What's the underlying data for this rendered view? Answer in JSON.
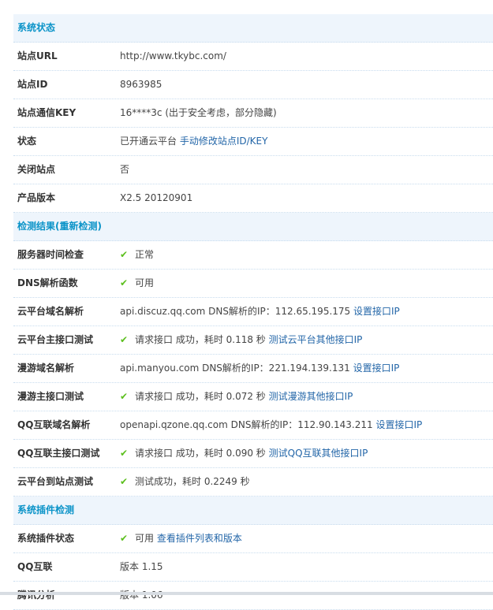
{
  "sections": [
    {
      "title": "系统状态",
      "rows": [
        {
          "label": "站点URL",
          "value": "http://www.tkybc.com/"
        },
        {
          "label": "站点ID",
          "value": "8963985"
        },
        {
          "label": "站点通信KEY",
          "value": "16****3c (出于安全考虑，部分隐藏)"
        },
        {
          "label": "状态",
          "value": "已开通云平台",
          "link": "手动修改站点ID/KEY"
        },
        {
          "label": "关闭站点",
          "value": "否"
        },
        {
          "label": "产品版本",
          "value": "X2.5 20120901"
        }
      ]
    },
    {
      "title": "检测结果(重新检测)",
      "rows": [
        {
          "label": "服务器时间检查",
          "ok": true,
          "value": "正常"
        },
        {
          "label": "DNS解析函数",
          "ok": true,
          "value": "可用"
        },
        {
          "label": "云平台域名解析",
          "value": "api.discuz.qq.com DNS解析的IP：112.65.195.175",
          "link": "设置接口IP"
        },
        {
          "label": "云平台主接口测试",
          "ok": true,
          "value": "请求接口 成功，耗时 0.118 秒",
          "link": "测试云平台其他接口IP"
        },
        {
          "label": "漫游域名解析",
          "value": "api.manyou.com DNS解析的IP：221.194.139.131",
          "link": "设置接口IP"
        },
        {
          "label": "漫游主接口测试",
          "ok": true,
          "value": "请求接口 成功，耗时 0.072 秒",
          "link": "测试漫游其他接口IP"
        },
        {
          "label": "QQ互联域名解析",
          "value": "openapi.qzone.qq.com DNS解析的IP：112.90.143.211",
          "link": "设置接口IP"
        },
        {
          "label": "QQ互联主接口测试",
          "ok": true,
          "value": "请求接口 成功，耗时 0.090 秒",
          "link": "测试QQ互联其他接口IP"
        },
        {
          "label": "云平台到站点测试",
          "ok": true,
          "value": "测试成功，耗时 0.2249 秒"
        }
      ]
    },
    {
      "title": "系统插件检测",
      "rows": [
        {
          "label": "系统插件状态",
          "ok": true,
          "value": "可用",
          "link": "查看插件列表和版本"
        },
        {
          "label": "QQ互联",
          "value": "版本 1.15"
        },
        {
          "label": "腾讯分析",
          "value": "版本 1.06"
        }
      ]
    }
  ],
  "colors": {
    "header_bg": "#eef5fc",
    "header_text": "#0a93c8",
    "link": "#2366a8",
    "check": "#5cbf1e"
  }
}
